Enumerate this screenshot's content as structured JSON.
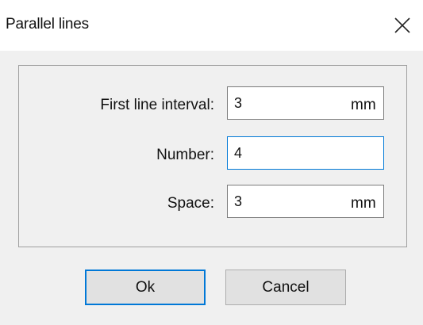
{
  "window": {
    "title": "Parallel lines",
    "close_glyph": "close-icon"
  },
  "form": {
    "first_line_interval": {
      "label": "First line interval:",
      "value": "3",
      "unit": "mm"
    },
    "number": {
      "label": "Number:",
      "value": "4"
    },
    "space": {
      "label": "Space:",
      "value": "3",
      "unit": "mm"
    }
  },
  "buttons": {
    "ok_label": "Ok",
    "cancel_label": "Cancel"
  },
  "colors": {
    "focus_accent": "#0078d7",
    "background": "#f0f0f0",
    "titlebar": "#ffffff"
  }
}
